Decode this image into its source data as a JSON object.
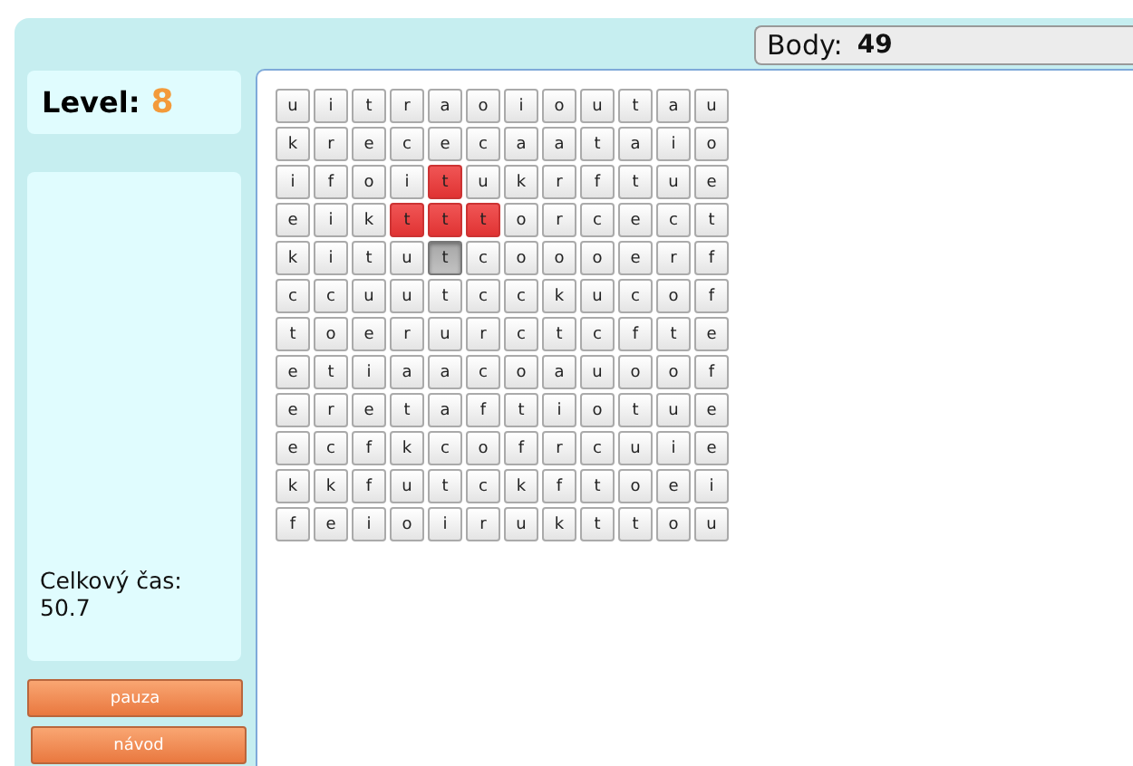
{
  "score": {
    "label": "Body:",
    "value": "49"
  },
  "level": {
    "label": "Level:",
    "value": "8"
  },
  "timer": {
    "label": "Celkový čas:",
    "value": "50.7"
  },
  "buttons": [
    "pauza",
    "návod"
  ],
  "grid": [
    {
      "cells": [
        {
          "letter": "u",
          "selected": false,
          "pressed": false
        },
        {
          "letter": "i",
          "selected": false,
          "pressed": false
        },
        {
          "letter": "t",
          "selected": false,
          "pressed": false
        },
        {
          "letter": "r",
          "selected": false,
          "pressed": false
        },
        {
          "letter": "a",
          "selected": false,
          "pressed": false
        },
        {
          "letter": "o",
          "selected": false,
          "pressed": false
        },
        {
          "letter": "i",
          "selected": false,
          "pressed": false
        },
        {
          "letter": "o",
          "selected": false,
          "pressed": false
        },
        {
          "letter": "u",
          "selected": false,
          "pressed": false
        },
        {
          "letter": "t",
          "selected": false,
          "pressed": false
        },
        {
          "letter": "a",
          "selected": false,
          "pressed": false
        },
        {
          "letter": "u",
          "selected": false,
          "pressed": false
        }
      ]
    },
    {
      "cells": [
        {
          "letter": "k",
          "selected": false,
          "pressed": false
        },
        {
          "letter": "r",
          "selected": false,
          "pressed": false
        },
        {
          "letter": "e",
          "selected": false,
          "pressed": false
        },
        {
          "letter": "c",
          "selected": false,
          "pressed": false
        },
        {
          "letter": "e",
          "selected": false,
          "pressed": false
        },
        {
          "letter": "c",
          "selected": false,
          "pressed": false
        },
        {
          "letter": "a",
          "selected": false,
          "pressed": false
        },
        {
          "letter": "a",
          "selected": false,
          "pressed": false
        },
        {
          "letter": "t",
          "selected": false,
          "pressed": false
        },
        {
          "letter": "a",
          "selected": false,
          "pressed": false
        },
        {
          "letter": "i",
          "selected": false,
          "pressed": false
        },
        {
          "letter": "o",
          "selected": false,
          "pressed": false
        }
      ]
    },
    {
      "cells": [
        {
          "letter": "i",
          "selected": false,
          "pressed": false
        },
        {
          "letter": "f",
          "selected": false,
          "pressed": false
        },
        {
          "letter": "o",
          "selected": false,
          "pressed": false
        },
        {
          "letter": "i",
          "selected": false,
          "pressed": false
        },
        {
          "letter": "t",
          "selected": true,
          "pressed": false
        },
        {
          "letter": "u",
          "selected": false,
          "pressed": false
        },
        {
          "letter": "k",
          "selected": false,
          "pressed": false
        },
        {
          "letter": "r",
          "selected": false,
          "pressed": false
        },
        {
          "letter": "f",
          "selected": false,
          "pressed": false
        },
        {
          "letter": "t",
          "selected": false,
          "pressed": false
        },
        {
          "letter": "u",
          "selected": false,
          "pressed": false
        },
        {
          "letter": "e",
          "selected": false,
          "pressed": false
        }
      ]
    },
    {
      "cells": [
        {
          "letter": "e",
          "selected": false,
          "pressed": false
        },
        {
          "letter": "i",
          "selected": false,
          "pressed": false
        },
        {
          "letter": "k",
          "selected": false,
          "pressed": false
        },
        {
          "letter": "t",
          "selected": true,
          "pressed": false
        },
        {
          "letter": "t",
          "selected": true,
          "pressed": false
        },
        {
          "letter": "t",
          "selected": true,
          "pressed": false
        },
        {
          "letter": "o",
          "selected": false,
          "pressed": false
        },
        {
          "letter": "r",
          "selected": false,
          "pressed": false
        },
        {
          "letter": "c",
          "selected": false,
          "pressed": false
        },
        {
          "letter": "e",
          "selected": false,
          "pressed": false
        },
        {
          "letter": "c",
          "selected": false,
          "pressed": false
        },
        {
          "letter": "t",
          "selected": false,
          "pressed": false
        }
      ]
    },
    {
      "cells": [
        {
          "letter": "k",
          "selected": false,
          "pressed": false
        },
        {
          "letter": "i",
          "selected": false,
          "pressed": false
        },
        {
          "letter": "t",
          "selected": false,
          "pressed": false
        },
        {
          "letter": "u",
          "selected": false,
          "pressed": false
        },
        {
          "letter": "t",
          "selected": false,
          "pressed": true
        },
        {
          "letter": "c",
          "selected": false,
          "pressed": false
        },
        {
          "letter": "o",
          "selected": false,
          "pressed": false
        },
        {
          "letter": "o",
          "selected": false,
          "pressed": false
        },
        {
          "letter": "o",
          "selected": false,
          "pressed": false
        },
        {
          "letter": "e",
          "selected": false,
          "pressed": false
        },
        {
          "letter": "r",
          "selected": false,
          "pressed": false
        },
        {
          "letter": "f",
          "selected": false,
          "pressed": false
        }
      ]
    },
    {
      "cells": [
        {
          "letter": "c",
          "selected": false,
          "pressed": false
        },
        {
          "letter": "c",
          "selected": false,
          "pressed": false
        },
        {
          "letter": "u",
          "selected": false,
          "pressed": false
        },
        {
          "letter": "u",
          "selected": false,
          "pressed": false
        },
        {
          "letter": "t",
          "selected": false,
          "pressed": false
        },
        {
          "letter": "c",
          "selected": false,
          "pressed": false
        },
        {
          "letter": "c",
          "selected": false,
          "pressed": false
        },
        {
          "letter": "k",
          "selected": false,
          "pressed": false
        },
        {
          "letter": "u",
          "selected": false,
          "pressed": false
        },
        {
          "letter": "c",
          "selected": false,
          "pressed": false
        },
        {
          "letter": "o",
          "selected": false,
          "pressed": false
        },
        {
          "letter": "f",
          "selected": false,
          "pressed": false
        }
      ]
    },
    {
      "cells": [
        {
          "letter": "t",
          "selected": false,
          "pressed": false
        },
        {
          "letter": "o",
          "selected": false,
          "pressed": false
        },
        {
          "letter": "e",
          "selected": false,
          "pressed": false
        },
        {
          "letter": "r",
          "selected": false,
          "pressed": false
        },
        {
          "letter": "u",
          "selected": false,
          "pressed": false
        },
        {
          "letter": "r",
          "selected": false,
          "pressed": false
        },
        {
          "letter": "c",
          "selected": false,
          "pressed": false
        },
        {
          "letter": "t",
          "selected": false,
          "pressed": false
        },
        {
          "letter": "c",
          "selected": false,
          "pressed": false
        },
        {
          "letter": "f",
          "selected": false,
          "pressed": false
        },
        {
          "letter": "t",
          "selected": false,
          "pressed": false
        },
        {
          "letter": "e",
          "selected": false,
          "pressed": false
        }
      ]
    },
    {
      "cells": [
        {
          "letter": "e",
          "selected": false,
          "pressed": false
        },
        {
          "letter": "t",
          "selected": false,
          "pressed": false
        },
        {
          "letter": "i",
          "selected": false,
          "pressed": false
        },
        {
          "letter": "a",
          "selected": false,
          "pressed": false
        },
        {
          "letter": "a",
          "selected": false,
          "pressed": false
        },
        {
          "letter": "c",
          "selected": false,
          "pressed": false
        },
        {
          "letter": "o",
          "selected": false,
          "pressed": false
        },
        {
          "letter": "a",
          "selected": false,
          "pressed": false
        },
        {
          "letter": "u",
          "selected": false,
          "pressed": false
        },
        {
          "letter": "o",
          "selected": false,
          "pressed": false
        },
        {
          "letter": "o",
          "selected": false,
          "pressed": false
        },
        {
          "letter": "f",
          "selected": false,
          "pressed": false
        }
      ]
    },
    {
      "cells": [
        {
          "letter": "e",
          "selected": false,
          "pressed": false
        },
        {
          "letter": "r",
          "selected": false,
          "pressed": false
        },
        {
          "letter": "e",
          "selected": false,
          "pressed": false
        },
        {
          "letter": "t",
          "selected": false,
          "pressed": false
        },
        {
          "letter": "a",
          "selected": false,
          "pressed": false
        },
        {
          "letter": "f",
          "selected": false,
          "pressed": false
        },
        {
          "letter": "t",
          "selected": false,
          "pressed": false
        },
        {
          "letter": "i",
          "selected": false,
          "pressed": false
        },
        {
          "letter": "o",
          "selected": false,
          "pressed": false
        },
        {
          "letter": "t",
          "selected": false,
          "pressed": false
        },
        {
          "letter": "u",
          "selected": false,
          "pressed": false
        },
        {
          "letter": "e",
          "selected": false,
          "pressed": false
        }
      ]
    },
    {
      "cells": [
        {
          "letter": "e",
          "selected": false,
          "pressed": false
        },
        {
          "letter": "c",
          "selected": false,
          "pressed": false
        },
        {
          "letter": "f",
          "selected": false,
          "pressed": false
        },
        {
          "letter": "k",
          "selected": false,
          "pressed": false
        },
        {
          "letter": "c",
          "selected": false,
          "pressed": false
        },
        {
          "letter": "o",
          "selected": false,
          "pressed": false
        },
        {
          "letter": "f",
          "selected": false,
          "pressed": false
        },
        {
          "letter": "r",
          "selected": false,
          "pressed": false
        },
        {
          "letter": "c",
          "selected": false,
          "pressed": false
        },
        {
          "letter": "u",
          "selected": false,
          "pressed": false
        },
        {
          "letter": "i",
          "selected": false,
          "pressed": false
        },
        {
          "letter": "e",
          "selected": false,
          "pressed": false
        }
      ]
    },
    {
      "cells": [
        {
          "letter": "k",
          "selected": false,
          "pressed": false
        },
        {
          "letter": "k",
          "selected": false,
          "pressed": false
        },
        {
          "letter": "f",
          "selected": false,
          "pressed": false
        },
        {
          "letter": "u",
          "selected": false,
          "pressed": false
        },
        {
          "letter": "t",
          "selected": false,
          "pressed": false
        },
        {
          "letter": "c",
          "selected": false,
          "pressed": false
        },
        {
          "letter": "k",
          "selected": false,
          "pressed": false
        },
        {
          "letter": "f",
          "selected": false,
          "pressed": false
        },
        {
          "letter": "t",
          "selected": false,
          "pressed": false
        },
        {
          "letter": "o",
          "selected": false,
          "pressed": false
        },
        {
          "letter": "e",
          "selected": false,
          "pressed": false
        },
        {
          "letter": "i",
          "selected": false,
          "pressed": false
        }
      ]
    },
    {
      "cells": [
        {
          "letter": "f",
          "selected": false,
          "pressed": false
        },
        {
          "letter": "e",
          "selected": false,
          "pressed": false
        },
        {
          "letter": "i",
          "selected": false,
          "pressed": false
        },
        {
          "letter": "o",
          "selected": false,
          "pressed": false
        },
        {
          "letter": "i",
          "selected": false,
          "pressed": false
        },
        {
          "letter": "r",
          "selected": false,
          "pressed": false
        },
        {
          "letter": "u",
          "selected": false,
          "pressed": false
        },
        {
          "letter": "k",
          "selected": false,
          "pressed": false
        },
        {
          "letter": "t",
          "selected": false,
          "pressed": false
        },
        {
          "letter": "t",
          "selected": false,
          "pressed": false
        },
        {
          "letter": "o",
          "selected": false,
          "pressed": false
        },
        {
          "letter": "u",
          "selected": false,
          "pressed": false
        }
      ]
    }
  ]
}
